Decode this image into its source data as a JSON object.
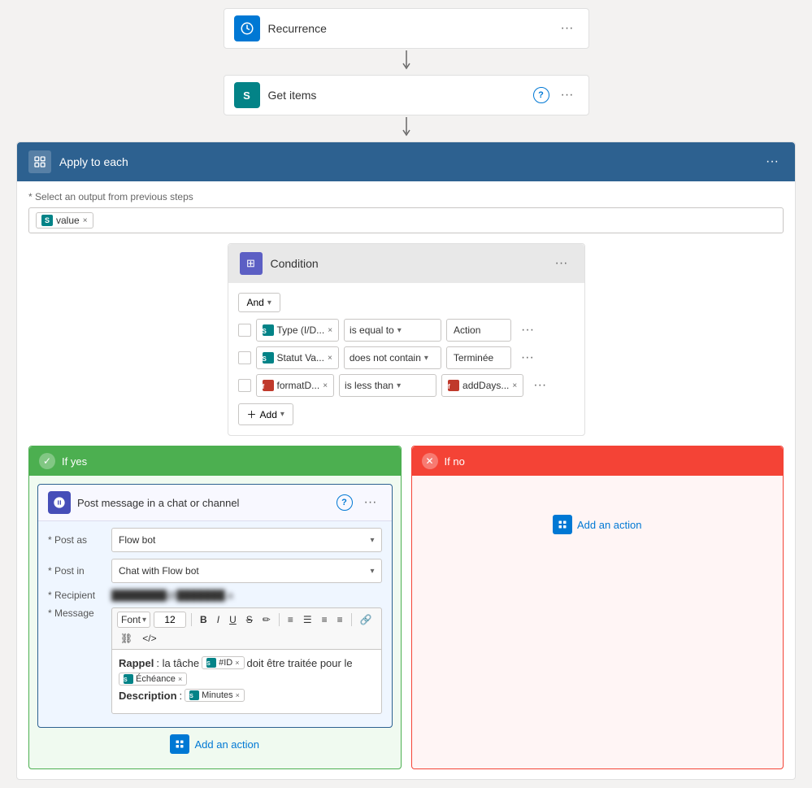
{
  "nodes": {
    "recurrence": {
      "title": "Recurrence",
      "icon_color": "#0078d4"
    },
    "get_items": {
      "title": "Get items",
      "icon_color": "#038387"
    },
    "apply_each": {
      "title": "Apply to each",
      "select_label": "* Select an output from previous steps",
      "token_value": "value"
    },
    "condition": {
      "title": "Condition",
      "and_label": "And",
      "rows": [
        {
          "left_token": "Type (I/D...",
          "operator": "is equal to",
          "right_value": "Action"
        },
        {
          "left_token": "Statut Va...",
          "operator": "does not contain",
          "right_value": "Terminée"
        },
        {
          "left_token": "formatD...",
          "operator": "is less than",
          "right_token": "addDays..."
        }
      ],
      "add_label": "Add"
    },
    "branch_yes": {
      "title": "If yes",
      "icon": "✓"
    },
    "branch_no": {
      "title": "If no",
      "icon": "✕"
    },
    "post_message": {
      "title": "Post message in a chat or channel",
      "post_as_label": "* Post as",
      "post_as_value": "Flow bot",
      "post_in_label": "* Post in",
      "post_in_value": "Chat with Flow bot",
      "recipient_label": "* Recipient",
      "recipient_placeholder": "user@domain.com",
      "message_label": "* Message",
      "font_label": "Font",
      "font_size": "12",
      "toolbar_buttons": [
        "B",
        "I",
        "U",
        "S",
        "≡",
        "☰",
        "≡",
        "≡",
        "🔗",
        "🔗",
        "</>"
      ],
      "message_text_1": "Rappel",
      "message_bold_1": " : la tâche",
      "message_token_1": "#ID",
      "message_text_2": " doit être traitée pour le",
      "message_label_2": "Échéance",
      "message_label_3": "Description",
      "message_token_3": "Minutes"
    },
    "add_action": {
      "label": "Add an action",
      "label_no": "Add an action"
    }
  }
}
